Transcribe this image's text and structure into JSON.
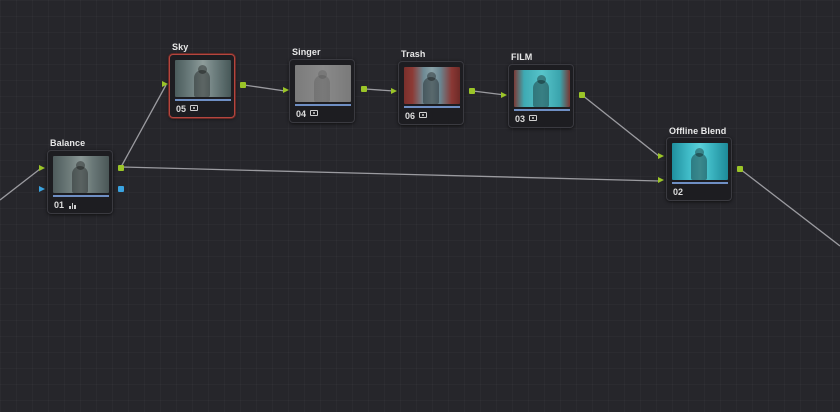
{
  "nodes": [
    {
      "id": "sky",
      "label": "Sky",
      "number": "05",
      "icon": "adjustment-icon",
      "selected": true
    },
    {
      "id": "singer",
      "label": "Singer",
      "number": "04",
      "icon": "adjustment-icon"
    },
    {
      "id": "trash",
      "label": "Trash",
      "number": "06",
      "icon": "adjustment-icon"
    },
    {
      "id": "film",
      "label": "FILM",
      "number": "03",
      "icon": "adjustment-icon"
    },
    {
      "id": "balance",
      "label": "Balance",
      "number": "01",
      "icon": "bars-icon"
    },
    {
      "id": "blend",
      "label": "Offline Blend",
      "number": "02",
      "icon": ""
    }
  ],
  "colors": {
    "background": "#26262b",
    "wire": "#9b9ba0",
    "output_port": "#9bc528",
    "key_port": "#3aa3e0",
    "selected_border": "#b4463f",
    "progress_bar": "#6f8fc4"
  }
}
